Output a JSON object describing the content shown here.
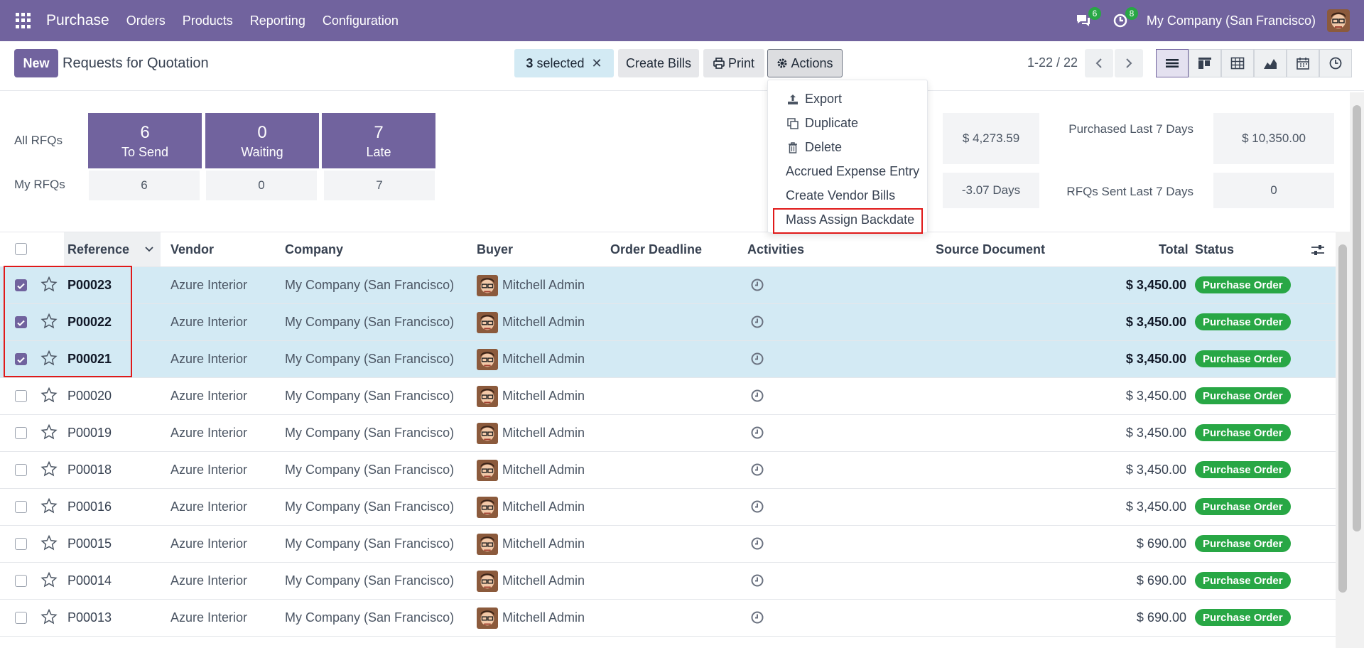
{
  "navbar": {
    "brand": "Purchase",
    "menu": [
      "Orders",
      "Products",
      "Reporting",
      "Configuration"
    ],
    "messages_count": "6",
    "activities_count": "8",
    "company": "My Company (San Francisco)",
    "color": "#71639e"
  },
  "control": {
    "new_label": "New",
    "title": "Requests for Quotation",
    "selected_count": "3",
    "selected_label": "selected",
    "clear_icon": "✕",
    "create_bills_label": "Create Bills",
    "print_label": "Print",
    "actions_label": "Actions",
    "pager": "1-22 / 22",
    "views": [
      "list-icon",
      "kanban-icon",
      "pivot-icon",
      "graph-icon",
      "calendar-icon",
      "activity-icon"
    ]
  },
  "actions_menu": {
    "items": [
      {
        "label": "Export",
        "icon": "upload-icon"
      },
      {
        "label": "Duplicate",
        "icon": "copy-icon"
      },
      {
        "label": "Delete",
        "icon": "trash-icon"
      },
      {
        "label": "Accrued Expense Entry",
        "icon": ""
      },
      {
        "label": "Create Vendor Bills",
        "icon": ""
      },
      {
        "label": "Mass Assign Backdate",
        "icon": ""
      }
    ],
    "highlighted": "Mass Assign Backdate"
  },
  "dashboard": {
    "all_rfqs_label": "All RFQs",
    "my_rfqs_label": "My RFQs",
    "tiles": [
      {
        "value": "6",
        "label": "To Send",
        "mine": "6"
      },
      {
        "value": "0",
        "label": "Waiting",
        "mine": "0"
      },
      {
        "value": "7",
        "label": "Late",
        "mine": "7"
      }
    ],
    "stats": {
      "avg_order_value": "$ 4,273.59",
      "purchased_last_7_label": "Purchased Last 7 Days",
      "purchased_last_7": "$ 10,350.00",
      "lead_time": "-3.07 Days",
      "rfqs_sent_label": "RFQs Sent Last 7 Days",
      "rfqs_sent": "0"
    }
  },
  "table": {
    "headers": {
      "reference": "Reference",
      "vendor": "Vendor",
      "company": "Company",
      "buyer": "Buyer",
      "deadline": "Order Deadline",
      "activities": "Activities",
      "source": "Source Document",
      "total": "Total",
      "status": "Status"
    },
    "rows": [
      {
        "ref": "P00023",
        "vendor": "Azure Interior",
        "company": "My Company (San Francisco)",
        "buyer": "Mitchell Admin",
        "total": "$ 3,450.00",
        "status": "Purchase Order",
        "selected": true
      },
      {
        "ref": "P00022",
        "vendor": "Azure Interior",
        "company": "My Company (San Francisco)",
        "buyer": "Mitchell Admin",
        "total": "$ 3,450.00",
        "status": "Purchase Order",
        "selected": true
      },
      {
        "ref": "P00021",
        "vendor": "Azure Interior",
        "company": "My Company (San Francisco)",
        "buyer": "Mitchell Admin",
        "total": "$ 3,450.00",
        "status": "Purchase Order",
        "selected": true
      },
      {
        "ref": "P00020",
        "vendor": "Azure Interior",
        "company": "My Company (San Francisco)",
        "buyer": "Mitchell Admin",
        "total": "$ 3,450.00",
        "status": "Purchase Order",
        "selected": false
      },
      {
        "ref": "P00019",
        "vendor": "Azure Interior",
        "company": "My Company (San Francisco)",
        "buyer": "Mitchell Admin",
        "total": "$ 3,450.00",
        "status": "Purchase Order",
        "selected": false
      },
      {
        "ref": "P00018",
        "vendor": "Azure Interior",
        "company": "My Company (San Francisco)",
        "buyer": "Mitchell Admin",
        "total": "$ 3,450.00",
        "status": "Purchase Order",
        "selected": false
      },
      {
        "ref": "P00016",
        "vendor": "Azure Interior",
        "company": "My Company (San Francisco)",
        "buyer": "Mitchell Admin",
        "total": "$ 3,450.00",
        "status": "Purchase Order",
        "selected": false
      },
      {
        "ref": "P00015",
        "vendor": "Azure Interior",
        "company": "My Company (San Francisco)",
        "buyer": "Mitchell Admin",
        "total": "$ 690.00",
        "status": "Purchase Order",
        "selected": false
      },
      {
        "ref": "P00014",
        "vendor": "Azure Interior",
        "company": "My Company (San Francisco)",
        "buyer": "Mitchell Admin",
        "total": "$ 690.00",
        "status": "Purchase Order",
        "selected": false
      },
      {
        "ref": "P00013",
        "vendor": "Azure Interior",
        "company": "My Company (San Francisco)",
        "buyer": "Mitchell Admin",
        "total": "$ 690.00",
        "status": "Purchase Order",
        "selected": false
      }
    ]
  }
}
